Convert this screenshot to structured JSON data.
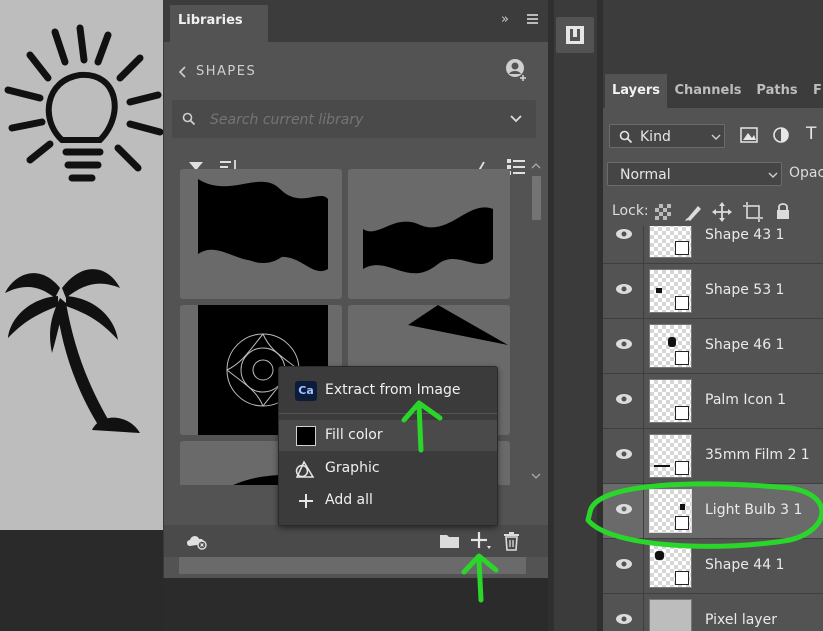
{
  "libraries_panel": {
    "tab_label": "Libraries",
    "collapse_glyph": "»",
    "back_label": "SHAPES",
    "search_placeholder": "Search current library",
    "icons": [
      "chevron-left-icon",
      "user-add-icon",
      "search-icon",
      "chevron-down-icon",
      "filter-icon",
      "sort-icon",
      "path-icon",
      "list-view-icon",
      "cloud-sync-icon",
      "folder-icon",
      "add-icon",
      "trash-icon"
    ]
  },
  "popup_menu": {
    "items": [
      {
        "label": "Extract from Image",
        "badge": "Ca"
      },
      {
        "label": "Fill color"
      },
      {
        "label": "Graphic"
      },
      {
        "label": "Add all"
      }
    ]
  },
  "layers_panel": {
    "tabs": [
      "Layers",
      "Channels",
      "Paths",
      "F"
    ],
    "filter_kind": "Kind",
    "blend_mode": "Normal",
    "opacity_label": "Opaci",
    "lock_label": "Lock:",
    "layers": [
      {
        "name": "Shape 43 1",
        "selected": false
      },
      {
        "name": "Shape 53 1",
        "selected": false
      },
      {
        "name": "Shape 46 1",
        "selected": false
      },
      {
        "name": "Palm Icon 1",
        "selected": false
      },
      {
        "name": "35mm Film 2 1",
        "selected": false
      },
      {
        "name": "Light Bulb 3 1",
        "selected": true
      },
      {
        "name": "Shape 44 1",
        "selected": false
      },
      {
        "name": "Pixel layer",
        "selected": false
      }
    ]
  },
  "colors": {
    "annotation_green": "#2bd62b",
    "panel_bg": "#535353",
    "selected_row": "#6a6a6a"
  }
}
